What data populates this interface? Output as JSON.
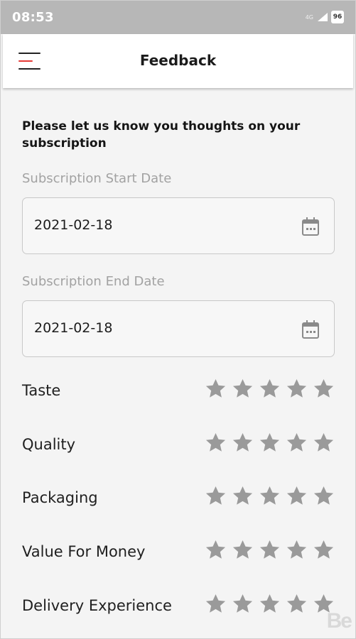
{
  "status_bar": {
    "time": "08:53",
    "signal_label": "4G",
    "battery": "96"
  },
  "app_bar": {
    "title": "Feedback",
    "menu_icon": "hamburger-menu-icon"
  },
  "form": {
    "intro": "Please let us know you thoughts on your subscription",
    "start_date": {
      "label": "Subscription Start Date",
      "value": "2021-02-18",
      "icon": "calendar-icon"
    },
    "end_date": {
      "label": "Subscription End Date",
      "value": "2021-02-18",
      "icon": "calendar-icon"
    }
  },
  "ratings": [
    {
      "label": "Taste",
      "value": 0,
      "max": 5
    },
    {
      "label": "Quality",
      "value": 0,
      "max": 5
    },
    {
      "label": "Packaging",
      "value": 0,
      "max": 5
    },
    {
      "label": "Value For Money",
      "value": 0,
      "max": 5
    },
    {
      "label": "Delivery Experience",
      "value": 0,
      "max": 5
    }
  ],
  "watermark": "Be",
  "colors": {
    "star_empty": "#9a9a9a",
    "menu_accent": "#e53935",
    "status_bar": "#b7b7b7"
  }
}
